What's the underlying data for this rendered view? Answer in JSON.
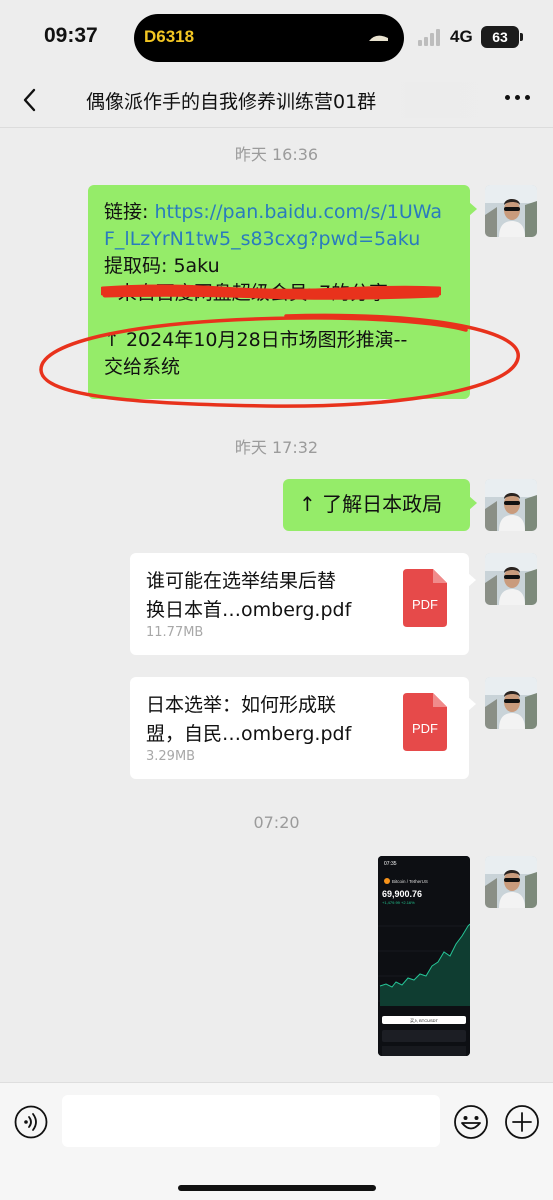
{
  "status": {
    "time": "09:37",
    "island_code": "D6318",
    "network": "4G",
    "battery": "63"
  },
  "nav": {
    "title": "偶像派作手的自我修养训练营01群"
  },
  "messages": {
    "ts1": "昨天 16:36",
    "msg1": {
      "link_label": "链接: ",
      "link_part1": "https://pan.baidu.com/s/1UWa",
      "link_part2": "F_lLzYrN1tw5_s83cxg?pwd=5aku",
      "code_line": "提取码: 5aku",
      "share_line": "--来自百度网盘超级会员v7的分享",
      "arrow_line1": "↑ 2024年10月28日市场图形推演--",
      "arrow_line2": "交给系统"
    },
    "ts2": "昨天 17:32",
    "msg2": "↑ 了解日本政局",
    "file1": {
      "name_line1": "谁可能在选举结果后替",
      "name_line2": "换日本首…omberg.pdf",
      "size": "11.77MB",
      "icon_label": "PDF"
    },
    "file2": {
      "name_line1": "日本选举：如何形成联",
      "name_line2": "盟，自民…omberg.pdf",
      "size": "3.29MB",
      "icon_label": "PDF"
    },
    "ts3": "07:20",
    "screenshot": {
      "status_time": "07:35",
      "pair": "Bitcoin / TetherUS",
      "price": "69,900.76",
      "change": "+1,479.99 +2.16%",
      "button": "买入 BTCUSDT"
    }
  },
  "colors": {
    "bubble_green": "#95ec69",
    "link": "#2a7bbd",
    "pdf_red": "#e64a4a",
    "annotation_red": "#e8321c"
  }
}
